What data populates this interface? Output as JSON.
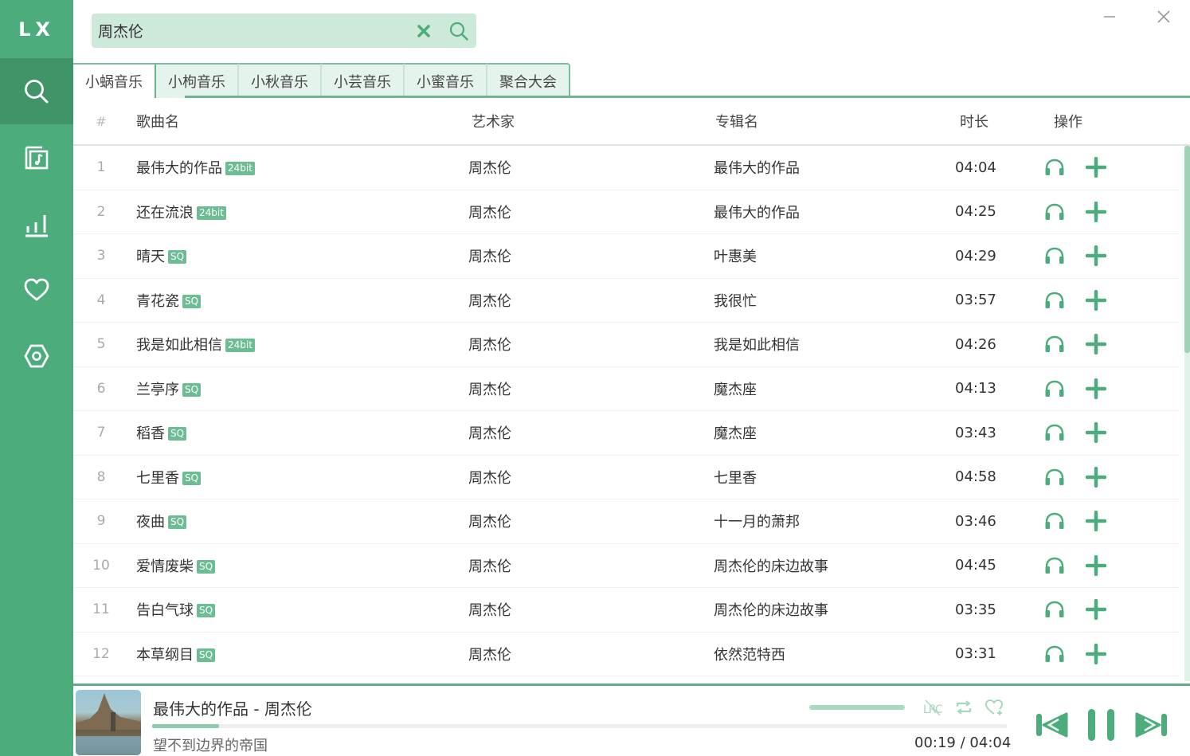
{
  "app": {
    "logo": "LX",
    "accent_color": "#4dac7b"
  },
  "sidebar": {
    "items": [
      {
        "name": "search",
        "icon": "search-icon",
        "active": true
      },
      {
        "name": "playlist",
        "icon": "music-list-icon",
        "active": false
      },
      {
        "name": "leaderboard",
        "icon": "chart-icon",
        "active": false
      },
      {
        "name": "favorites",
        "icon": "heart-icon",
        "active": false
      },
      {
        "name": "settings",
        "icon": "gear-icon",
        "active": false
      }
    ]
  },
  "search": {
    "value": "周杰伦",
    "placeholder": "",
    "clear_icon": "close-icon",
    "search_icon": "search-icon"
  },
  "window": {
    "minimize_icon": "minimize-icon",
    "close_icon": "close-icon"
  },
  "tabs": [
    {
      "label": "小蜗音乐",
      "active": true
    },
    {
      "label": "小枸音乐",
      "active": false
    },
    {
      "label": "小秋音乐",
      "active": false
    },
    {
      "label": "小芸音乐",
      "active": false
    },
    {
      "label": "小蜜音乐",
      "active": false
    },
    {
      "label": "聚合大会",
      "active": false
    }
  ],
  "table": {
    "headers": {
      "num": "#",
      "name": "歌曲名",
      "artist": "艺术家",
      "album": "专辑名",
      "duration": "时长",
      "ops": "操作"
    },
    "rows": [
      {
        "num": "1",
        "name": "最伟大的作品",
        "badge": "24bit",
        "artist": "周杰伦",
        "album": "最伟大的作品",
        "duration": "04:04"
      },
      {
        "num": "2",
        "name": "还在流浪",
        "badge": "24bit",
        "artist": "周杰伦",
        "album": "最伟大的作品",
        "duration": "04:25"
      },
      {
        "num": "3",
        "name": "晴天",
        "badge": "SQ",
        "artist": "周杰伦",
        "album": "叶惠美",
        "duration": "04:29"
      },
      {
        "num": "4",
        "name": "青花瓷",
        "badge": "SQ",
        "artist": "周杰伦",
        "album": "我很忙",
        "duration": "03:57"
      },
      {
        "num": "5",
        "name": "我是如此相信",
        "badge": "24bit",
        "artist": "周杰伦",
        "album": "我是如此相信",
        "duration": "04:26"
      },
      {
        "num": "6",
        "name": "兰亭序",
        "badge": "SQ",
        "artist": "周杰伦",
        "album": "魔杰座",
        "duration": "04:13"
      },
      {
        "num": "7",
        "name": "稻香",
        "badge": "SQ",
        "artist": "周杰伦",
        "album": "魔杰座",
        "duration": "03:43"
      },
      {
        "num": "8",
        "name": "七里香",
        "badge": "SQ",
        "artist": "周杰伦",
        "album": "七里香",
        "duration": "04:58"
      },
      {
        "num": "9",
        "name": "夜曲",
        "badge": "SQ",
        "artist": "周杰伦",
        "album": "十一月的萧邦",
        "duration": "03:46"
      },
      {
        "num": "10",
        "name": "爱情废柴",
        "badge": "SQ",
        "artist": "周杰伦",
        "album": "周杰伦的床边故事",
        "duration": "04:45"
      },
      {
        "num": "11",
        "name": "告白气球",
        "badge": "SQ",
        "artist": "周杰伦",
        "album": "周杰伦的床边故事",
        "duration": "03:35"
      },
      {
        "num": "12",
        "name": "本草纲目",
        "badge": "SQ",
        "artist": "周杰伦",
        "album": "依然范特西",
        "duration": "03:31"
      }
    ],
    "row_ops": [
      {
        "icon": "headphones-icon",
        "label": "试听"
      },
      {
        "icon": "plus-icon",
        "label": "添加"
      }
    ]
  },
  "player": {
    "title": "最伟大的作品 - 周杰伦",
    "lyric": "望不到边界的帝国",
    "current_time": "00:19",
    "separator": "/",
    "total_time": "04:04",
    "progress_fraction": 0.078,
    "volume_fraction": 1.0,
    "icons": [
      "lyric-off-icon",
      "repeat-icon",
      "add-favorite-icon",
      "previous-icon",
      "pause-icon",
      "next-icon"
    ]
  }
}
